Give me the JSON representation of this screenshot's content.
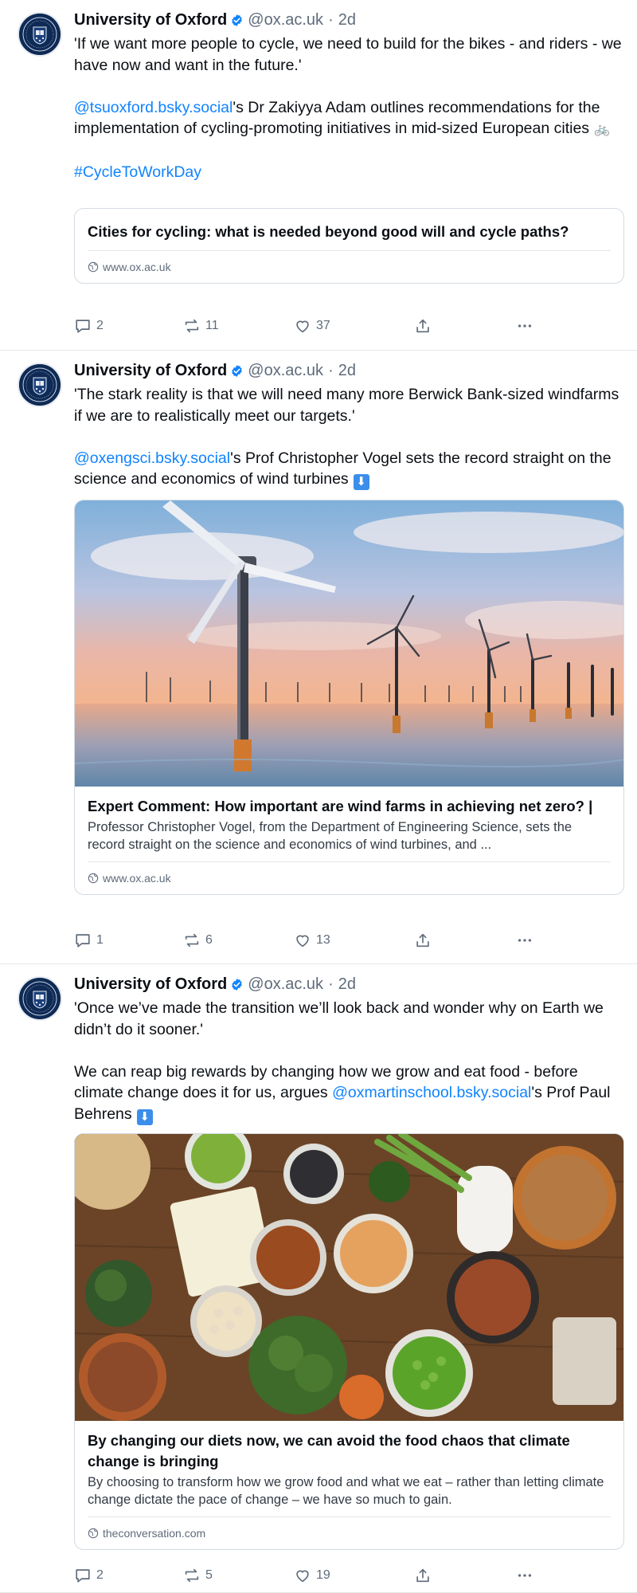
{
  "colors": {
    "link": "#1083fe",
    "muted": "#5f6b7a",
    "text": "#0b0f14",
    "verified": "#1083fe"
  },
  "icons": {
    "reply": "speech-bubble-icon",
    "repost": "repost-arrows-icon",
    "like": "heart-icon",
    "share": "share-upload-icon",
    "more": "ellipsis-icon",
    "domain": "globe-icon",
    "verified": "verified-badge-icon"
  },
  "posts": [
    {
      "author": "University of Oxford",
      "handle": "@ox.ac.uk",
      "time": "2d",
      "separator": "·",
      "p1": "'If we want more people to cycle, we need to build for the bikes - and riders - we have now and want in the future.'",
      "mention": "@tsuoxford.bsky.social",
      "p2_rest": "'s Dr Zakiyya Adam outlines recommendations for the implementation of cycling-promoting initiatives in mid-sized European cities",
      "emoji": "🚲",
      "hashtag": "#CycleToWorkDay",
      "card": {
        "title": "Cities for cycling: what is needed beyond good will and cycle paths?",
        "domain": "www.ox.ac.uk"
      },
      "counts": {
        "reply": "2",
        "repost": "11",
        "like": "37"
      }
    },
    {
      "author": "University of Oxford",
      "handle": "@ox.ac.uk",
      "time": "2d",
      "separator": "·",
      "p1": "'The stark reality is that we will need many more Berwick Bank-sized windfarms if we are to realistically meet our targets.'",
      "mention": "@oxengsci.bsky.social",
      "p2_rest": "'s Prof Christopher Vogel sets the record straight on the science and economics of wind turbines",
      "emoji": "⬇",
      "card": {
        "title": "Expert Comment: How important are wind farms in achieving net zero? |",
        "description": "Professor Christopher Vogel, from the Department of Engineering Science, sets the record straight on the science and economics of wind turbines, and ...",
        "domain": "www.ox.ac.uk"
      },
      "counts": {
        "reply": "1",
        "repost": "6",
        "like": "13"
      }
    },
    {
      "author": "University of Oxford",
      "handle": "@ox.ac.uk",
      "time": "2d",
      "separator": "·",
      "p1": "'Once we’ve made the transition we’ll look back and wonder why on Earth we didn’t do it sooner.'",
      "p2_start": "We can reap big rewards by changing how we grow and eat food - before climate change does it for us, argues",
      "mention": "@oxmartinschool.bsky.social",
      "p2_rest": "'s Prof Paul Behrens",
      "emoji": "⬇",
      "card": {
        "title": "By changing our diets now, we can avoid the food chaos that climate change is bringing",
        "description": "By choosing to transform how we grow food and what we eat – rather than letting climate change dictate the pace of change – we have so much to gain.",
        "domain": "theconversation.com"
      },
      "counts": {
        "reply": "2",
        "repost": "5",
        "like": "19"
      }
    }
  ]
}
